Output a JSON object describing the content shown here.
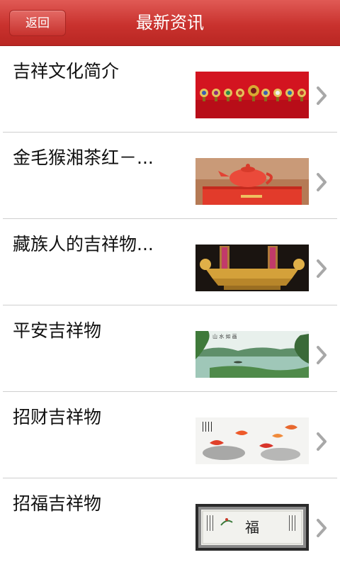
{
  "header": {
    "back_label": "返回",
    "title": "最新资讯"
  },
  "colors": {
    "header_red": "#c9322e",
    "divider": "#cfcfcf",
    "chevron": "#a8a8a8"
  },
  "articles": [
    {
      "title": "吉祥文化简介",
      "thumbnail": "eight-auspicious-symbols-image"
    },
    {
      "title": "金毛猴湘茶红－...",
      "thumbnail": "red-teapot-image"
    },
    {
      "title": "藏族人的吉祥物...",
      "thumbnail": "golden-dragon-carving-image"
    },
    {
      "title": "平安吉祥物",
      "thumbnail": "lake-landscape-painting-image"
    },
    {
      "title": "招财吉祥物",
      "thumbnail": "koi-fish-painting-image"
    },
    {
      "title": "招福吉祥物",
      "thumbnail": "fu-calligraphy-scroll-image"
    }
  ]
}
